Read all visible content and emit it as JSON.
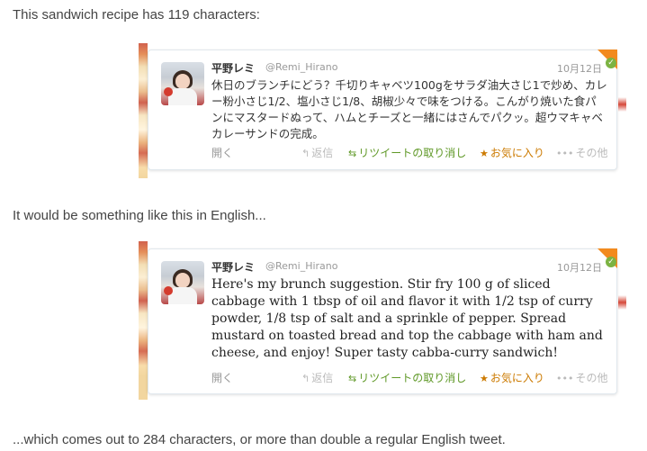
{
  "intro_text": "This sandwich recipe has 119 characters:",
  "middle_text": "It would be something like this in English...",
  "outro_text": "...which comes out to 284 characters, or more than double a regular English tweet.",
  "tweets": [
    {
      "name": "平野レミ",
      "handle": "@Remi_Hirano",
      "date": "10月12日",
      "text": "休日のブランチにどう？千切りキャベツ100gをサラダ油大さじ1で炒め、カレー粉小さじ1/2、塩小さじ1/8、胡椒少々で味をつける。こんがり焼いた食パンにマスタードぬって、ハムとチーズと一緒にはさんでパクッ。超ウマキャベカレーサンドの完成。",
      "actions": {
        "open": "開く",
        "reply": "返信",
        "retweet_undo": "リツイートの取り消し",
        "favorite": "お気に入り",
        "more": "その他"
      }
    },
    {
      "name": "平野レミ",
      "handle": "@Remi_Hirano",
      "date": "10月12日",
      "text": "Here's my brunch suggestion. Stir fry 100 g of sliced cabbage with 1 tbsp of oil and flavor it with 1/2 tsp of curry powder, 1/8 tsp of salt and a sprinkle of pepper. Spread mustard on toasted bread and top the cabbage with ham and cheese, and enjoy! Super tasty cabba-curry sandwich!",
      "actions": {
        "open": "開く",
        "reply": "返信",
        "retweet_undo": "リツイートの取り消し",
        "favorite": "お気に入り",
        "more": "その他"
      }
    }
  ],
  "icons": {
    "reply": "reply-arrow-icon",
    "retweet": "retweet-icon",
    "favorite": "star-icon",
    "more": "dots-icon",
    "corner": "retweeted-corner-icon"
  },
  "colors": {
    "retweet_green": "#609928",
    "favorite_orange": "#cc7a00",
    "muted": "#999999",
    "corner_orange": "#f28a1e"
  }
}
